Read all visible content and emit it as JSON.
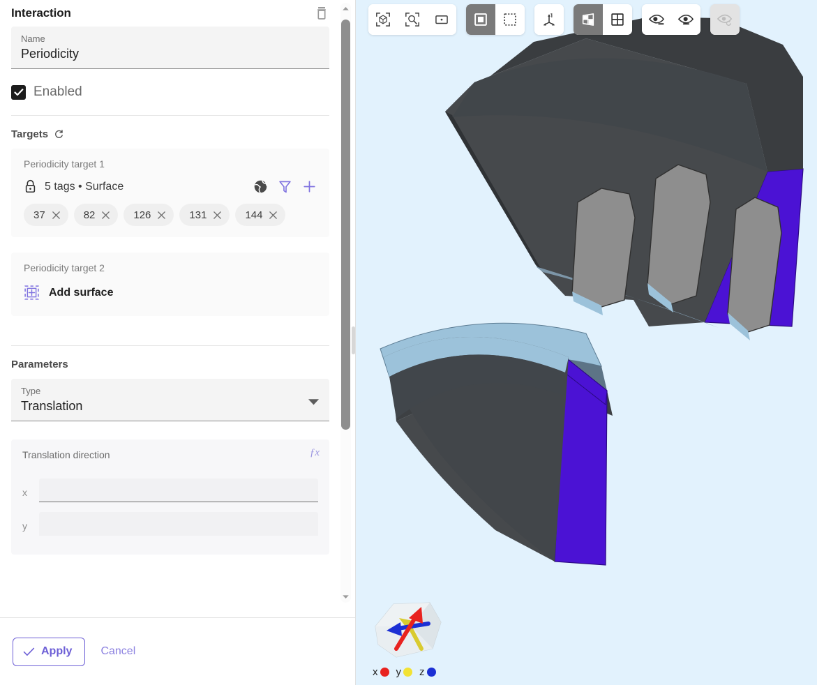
{
  "panel": {
    "title": "Interaction",
    "delete_icon": "trash-icon",
    "name_field": {
      "label": "Name",
      "value": "Periodicity"
    },
    "enabled": {
      "label": "Enabled",
      "checked": true
    },
    "targets": {
      "section_title": "Targets",
      "refresh_icon": "refresh-icon",
      "cards": [
        {
          "title": "Periodicity target 1",
          "lock_icon": "lock-icon",
          "summary": "5 tags • Surface",
          "actions": [
            "globe-icon",
            "filter-icon",
            "plus-icon"
          ],
          "tags": [
            "37",
            "82",
            "126",
            "131",
            "144"
          ]
        },
        {
          "title": "Periodicity target 2",
          "add_label": "Add surface",
          "add_icon": "add-surface-icon"
        }
      ]
    },
    "parameters": {
      "section_title": "Parameters",
      "type_field": {
        "label": "Type",
        "value": "Translation",
        "chevron": "chevron-down-icon"
      },
      "direction": {
        "label": "Translation direction",
        "fx_icon": "fx-icon",
        "fx_label": "ƒx",
        "components": [
          {
            "label": "x",
            "value": ""
          },
          {
            "label": "y",
            "value": ""
          }
        ]
      }
    },
    "footer": {
      "apply_label": "Apply",
      "apply_icon": "check-icon",
      "cancel_label": "Cancel"
    },
    "scrollbar": {
      "up_icon": "chevron-up-icon",
      "down_icon": "chevron-down-icon"
    }
  },
  "viewport": {
    "background_color": "#e2f2fd",
    "toolbar": {
      "groups": [
        {
          "name": "view-fit-group",
          "buttons": [
            {
              "name": "fit-all-icon",
              "active": false,
              "disabled": false
            },
            {
              "name": "zoom-to-selection-icon",
              "active": false,
              "disabled": false
            },
            {
              "name": "zoom-window-icon",
              "active": false,
              "disabled": false
            }
          ]
        },
        {
          "name": "selection-mode-group",
          "buttons": [
            {
              "name": "select-solid-icon",
              "active": true,
              "disabled": false
            },
            {
              "name": "select-box-icon",
              "active": false,
              "disabled": false
            }
          ]
        },
        {
          "name": "axes-group",
          "buttons": [
            {
              "name": "axis-triad-icon",
              "active": false,
              "disabled": false
            }
          ]
        },
        {
          "name": "display-mode-group",
          "buttons": [
            {
              "name": "shaded-perspective-icon",
              "active": true,
              "disabled": false
            },
            {
              "name": "grid-view-icon",
              "active": false,
              "disabled": false
            }
          ]
        },
        {
          "name": "visibility-group",
          "buttons": [
            {
              "name": "hide-selected-icon",
              "active": false,
              "disabled": false
            },
            {
              "name": "show-only-selected-icon",
              "active": false,
              "disabled": false
            }
          ]
        },
        {
          "name": "reset-visibility-group",
          "buttons": [
            {
              "name": "reset-visibility-icon",
              "active": false,
              "disabled": true
            }
          ]
        }
      ]
    },
    "axis_widget": {
      "name": "navigation-cube",
      "legend": [
        {
          "label": "x",
          "color": "#e8221f"
        },
        {
          "label": "y",
          "color": "#f2e234"
        },
        {
          "label": "z",
          "color": "#1b2fd4"
        }
      ]
    },
    "model": {
      "name": "motor-sector-3d-model",
      "colors": {
        "body_dark": "#3f4245",
        "body_dark_top": "#4b4e51",
        "magnet_gray": "#8e8e8e",
        "selected_purple": "#4b12d4",
        "light_blue": "#9cc2da",
        "steel_blue": "#5a7283"
      }
    }
  },
  "theme": {
    "accent": "#6d5fd6",
    "accent_light": "#8b80e0",
    "text_primary": "#1f1f1f",
    "text_muted": "#7a7a7a"
  }
}
